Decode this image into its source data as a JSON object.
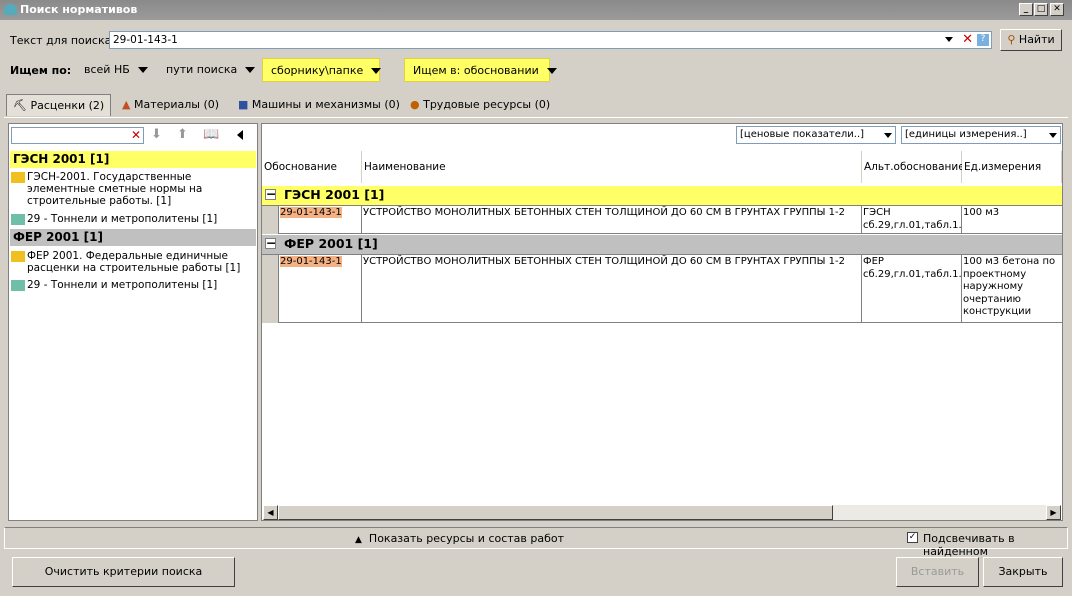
{
  "window": {
    "title": "Поиск нормативов"
  },
  "search": {
    "label": "Текст для поиска:",
    "value": "29-01-143-1",
    "find_label": "Найти"
  },
  "filters": {
    "label": "Ищем по:",
    "items": [
      "всей НБ",
      "пути поиска",
      "сборнику\\папке",
      "Ищем в: обосновании"
    ]
  },
  "tabs": [
    {
      "label": "Расценки (2)"
    },
    {
      "label": "Материалы (0)"
    },
    {
      "label": "Машины и механизмы (0)"
    },
    {
      "label": "Трудовые ресурсы (0)"
    }
  ],
  "tree": {
    "groups": [
      {
        "title": "ГЭСН 2001 [1]",
        "folder": "ГЭСН-2001. Государственные элементные сметные нормы на строительные работы. [1]",
        "item": "29 - Тоннели и метрополитены [1]"
      },
      {
        "title": "ФЕР 2001 [1]",
        "folder": "ФЕР 2001. Федеральные единичные расценки на строительные работы [1]",
        "item": "29 - Тоннели и метрополитены [1]"
      }
    ]
  },
  "grid": {
    "price_dropdown": "[ценовые показатели..]",
    "units_dropdown": "[единицы измерения..]",
    "columns": [
      "Обоснование",
      "Наименование",
      "Альт.обоснование",
      "Ед.измерения"
    ],
    "groups": [
      {
        "title": "ГЭСН 2001 [1]",
        "row": {
          "code": "29-01-143-1",
          "name": "УСТРОЙСТВО МОНОЛИТНЫХ БЕТОННЫХ СТЕН ТОЛЩИНОЙ ДО 60 СМ В ГРУНТАХ ГРУППЫ 1-2",
          "alt": "ГЭСН сб.29,гл.01,табл.1...",
          "unit": "100 м3"
        }
      },
      {
        "title": "ФЕР 2001 [1]",
        "row": {
          "code": "29-01-143-1",
          "name": "УСТРОЙСТВО МОНОЛИТНЫХ БЕТОННЫХ СТЕН ТОЛЩИНОЙ ДО 60 СМ В ГРУНТАХ ГРУППЫ 1-2",
          "alt": "ФЕР сб.29,гл.01,табл.1...",
          "unit": "100 м3 бетона по проектному наружному очертанию конструкции"
        }
      }
    ]
  },
  "bottom": {
    "show_resources": "Показать ресурсы и состав работ",
    "highlight_label": "Подсвечивать в найденном"
  },
  "buttons": {
    "clear": "Очистить критерии поиска",
    "insert": "Вставить",
    "close": "Закрыть"
  }
}
